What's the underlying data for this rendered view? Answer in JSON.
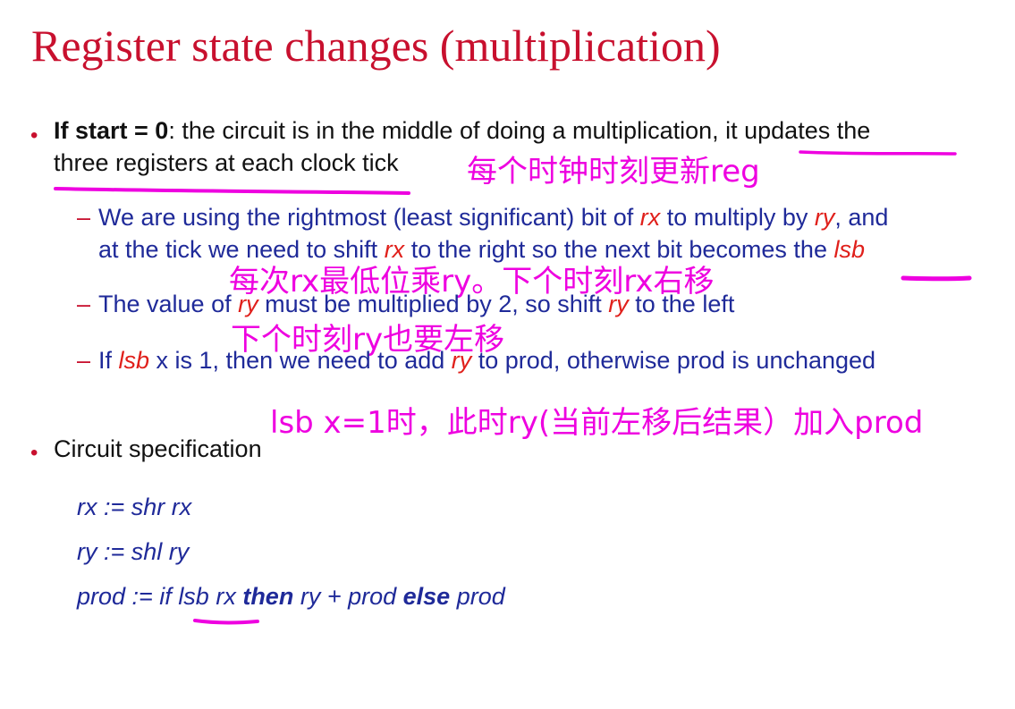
{
  "slide": {
    "title": "Register state changes (multiplication)",
    "bullet1": {
      "bold_lead": "If start = 0",
      "text_a": ": the circuit is in the middle of doing a multiplication, ",
      "text_b": "it updates the",
      "line2": "three registers at each clock tick"
    },
    "sub1": {
      "a1": "We are using the rightmost (least significant) bit of ",
      "v1": "rx",
      "a2": " to multiply by ",
      "v2": "ry",
      "a3": ", and",
      "b1": "at the tick we need to shift ",
      "v3": "rx",
      "b2": " to the right so the next bit becomes the ",
      "v4": "lsb"
    },
    "sub2": {
      "a1": "The value of ",
      "v1": "ry",
      "a2": " must be multiplied by 2, so shift ",
      "v2": "ry",
      "a3": " to the left"
    },
    "sub3": {
      "a1": "If ",
      "v1": "lsb",
      "a2": " x is 1, then we need to add ",
      "v2": "ry",
      "a3": " to prod, otherwise prod is unchanged"
    },
    "bullet2": "Circuit specification",
    "code": {
      "line1": "rx := shr rx",
      "line2": "ry := shl ry",
      "line3_a": "prod := if lsb rx ",
      "line3_then": "then",
      "line3_b": " ry + prod ",
      "line3_else": "else",
      "line3_c": " prod"
    }
  },
  "annotations": {
    "note1": "每个时钟时刻更新reg",
    "note2": "每次rx最低位乘ry。下个时刻rx右移",
    "note3": "下个时刻ry也要左移",
    "note4": "lsb x=1时，此时ry(当前左移后结果）加入prod"
  },
  "colors": {
    "title": "#c8102e",
    "sub_text": "#1f2a99",
    "variable": "#e0201b",
    "annotation": "#ee00e0"
  }
}
